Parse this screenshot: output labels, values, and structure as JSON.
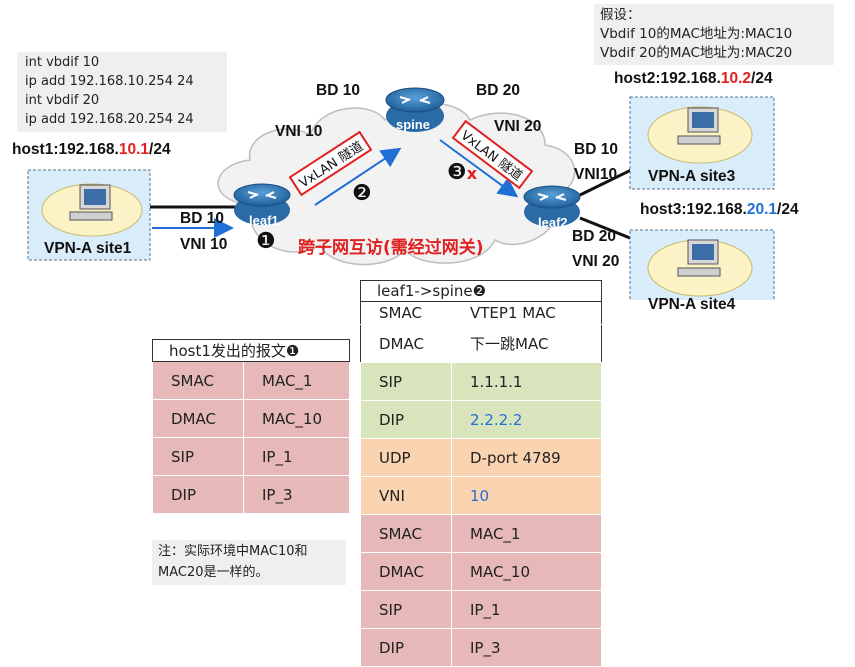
{
  "config_box": {
    "lines": [
      "int vbdif   10",
      "ip add 192.168.10.254  24",
      "int vbdif 20",
      "ip add 192.168.20.254  24"
    ]
  },
  "assume_box": {
    "lines": [
      "假设：",
      "Vbdif 10的MAC地址为:MAC10",
      "Vbdif 20的MAC地址为:MAC20"
    ]
  },
  "hosts": {
    "host1": {
      "prefix": "host1:192.168.",
      "highlight": "10.1",
      "suffix": "/24"
    },
    "host2": {
      "prefix": "host2:192.168.",
      "highlight": "10.2",
      "suffix": "/24"
    },
    "host3": {
      "prefix": "host3:192.168.",
      "highlight": "20.1",
      "suffix": "/24"
    }
  },
  "sites": {
    "site1": "VPN-A site1",
    "site3": "VPN-A site3",
    "site4": "VPN-A site4"
  },
  "routers": {
    "leaf1": "leaf1",
    "spine": "spine",
    "leaf2": "leaf2"
  },
  "labels": {
    "bd10_top": "BD 10",
    "bd20_top": "BD  20",
    "vni10_top": "VNI 10",
    "vni20_top": "VNI 20",
    "bd10_left": "BD 10",
    "vni10_left": "VNI 10",
    "bd10_right": "BD 10",
    "vni10_right": "VNI10",
    "bd20_right": "BD 20",
    "vni20_right": "VNI 20",
    "tunnel1": "VxLAN 隧道",
    "tunnel2": "VxLAN 隧道",
    "marker1": "❶",
    "marker2": "❷",
    "marker3": "❸",
    "marker3_x": "x",
    "cross_subnet": "跨子网互访(需经过网关)"
  },
  "host1_packet": {
    "title": "host1发出的报文❶",
    "rows": [
      {
        "field": "SMAC",
        "value": "MAC_1"
      },
      {
        "field": "DMAC",
        "value": "MAC_10"
      },
      {
        "field": "SIP",
        "value": "IP_1"
      },
      {
        "field": "DIP",
        "value": "IP_3"
      }
    ]
  },
  "spine_packet": {
    "title": "leaf1->spine❷",
    "rows": [
      {
        "field": "SMAC",
        "value": "VTEP1 MAC"
      },
      {
        "field": "DMAC",
        "value": "下一跳MAC"
      },
      {
        "field": "SIP",
        "value": "1.1.1.1"
      },
      {
        "field": "DIP",
        "value": "2.2.2.2"
      },
      {
        "field": "UDP",
        "value": "D-port 4789"
      },
      {
        "field": "VNI",
        "value": "10"
      },
      {
        "field": "SMAC",
        "value": "MAC_1"
      },
      {
        "field": "DMAC",
        "value": "MAC_10"
      },
      {
        "field": "SIP",
        "value": "IP_1"
      },
      {
        "field": "DIP",
        "value": "IP_3"
      }
    ]
  },
  "note": {
    "lines": [
      "注：实际环境中MAC10和",
      "MAC20是一样的。"
    ]
  },
  "colors": {
    "accent_red": "#e02020",
    "accent_blue": "#1f6fd6",
    "pink": "#e6b8b8",
    "green": "#d8e4bc",
    "orange": "#fad3b0"
  }
}
